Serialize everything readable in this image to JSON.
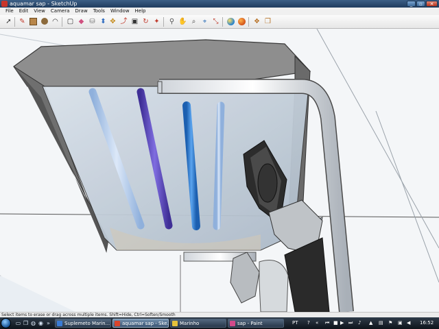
{
  "window": {
    "title": "aquamar sap - SketchUp"
  },
  "menu": [
    "File",
    "Edit",
    "View",
    "Camera",
    "Draw",
    "Tools",
    "Window",
    "Help"
  ],
  "toolbar": {
    "tools": [
      "select",
      "pencil",
      "rectangle",
      "circle",
      "arc",
      "eraser",
      "paint-bucket",
      "push-pull",
      "move",
      "rotate",
      "follow-me",
      "offset",
      "tape-measure",
      "text",
      "orbit",
      "pan",
      "zoom",
      "zoom-extents",
      "geo-location",
      "3d-warehouse",
      "components",
      "get-models"
    ]
  },
  "status": {
    "text": "Select items to erase or drag across multiple items. Shift=Hide, Ctrl=Soften/Smooth"
  },
  "taskbar": {
    "tasks": [
      {
        "label": "Suplemeto Marin...",
        "active": false,
        "icon_color": "#3a7bd5"
      },
      {
        "label": "aquamar sap - Ske...",
        "active": true,
        "icon_color": "#d9442c"
      },
      {
        "label": "Marinho",
        "active": false,
        "icon_color": "#e6c23a"
      },
      {
        "label": "sap - Paint",
        "active": false,
        "icon_color": "#d24a8a"
      }
    ],
    "lang": "PT",
    "clock": "16:52"
  },
  "colors": {
    "tube_light": "#a9c4e8",
    "tube_purple": "#5a46b4",
    "tube_blue": "#2e7ed8",
    "glass": "#c9d4e0",
    "hood": "#8e8e8e"
  }
}
